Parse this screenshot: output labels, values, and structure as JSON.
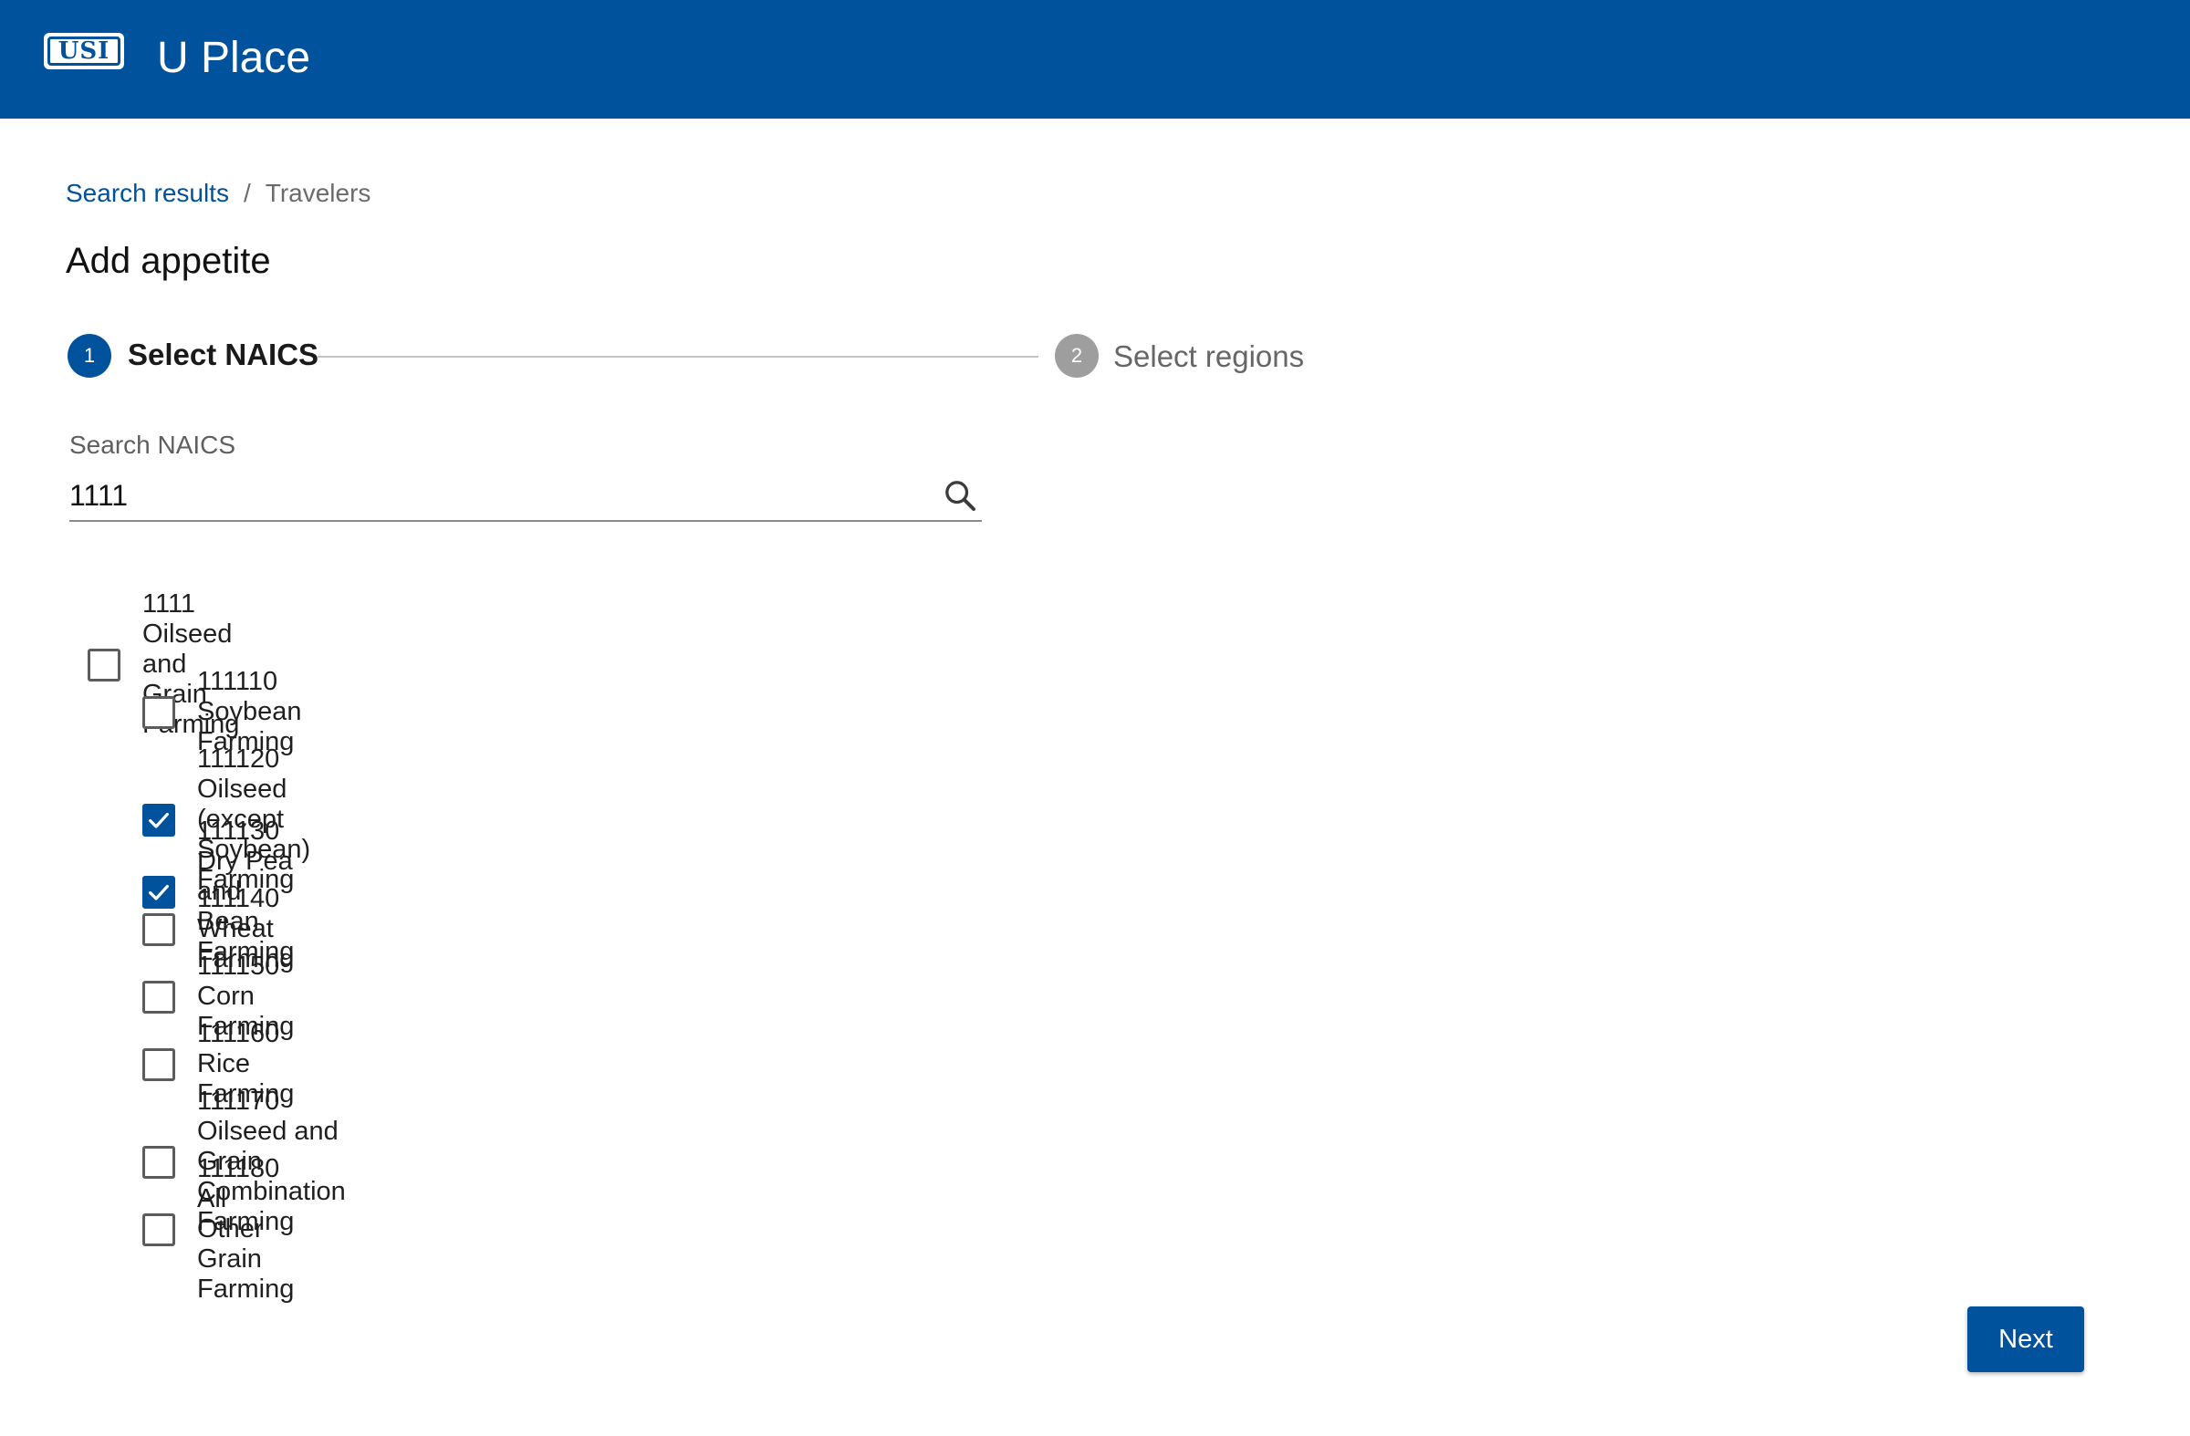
{
  "header": {
    "logo_text": "USI",
    "app_title": "U Place",
    "brand_color": "#00529c"
  },
  "breadcrumb": {
    "parent": "Search results",
    "separator": "/",
    "current": "Travelers"
  },
  "page_title": "Add appetite",
  "stepper": {
    "steps": [
      {
        "number": "1",
        "label": "Select NAICS",
        "state": "active"
      },
      {
        "number": "2",
        "label": "Select regions",
        "state": "inactive"
      }
    ]
  },
  "search": {
    "label": "Search NAICS",
    "value": "1111",
    "icon": "search-icon"
  },
  "naics": {
    "parent": {
      "label": "1111 Oilseed and Grain Farming",
      "checked": false
    },
    "children": [
      {
        "label": "111110 Soybean Farming",
        "checked": false
      },
      {
        "label": "111120 Oilseed (except Soybean) Farming",
        "checked": true
      },
      {
        "label": "111130 Dry Pea and Bean Farming",
        "checked": true
      },
      {
        "label": "111140 Wheat Farming",
        "checked": false
      },
      {
        "label": "111150 Corn Farming",
        "checked": false
      },
      {
        "label": "111160 Rice Farming",
        "checked": false
      },
      {
        "label": "111170 Oilseed and Grain Combination Farming",
        "checked": false
      },
      {
        "label": "111180 All Other Grain Farming",
        "checked": false
      }
    ]
  },
  "actions": {
    "next_label": "Next"
  }
}
